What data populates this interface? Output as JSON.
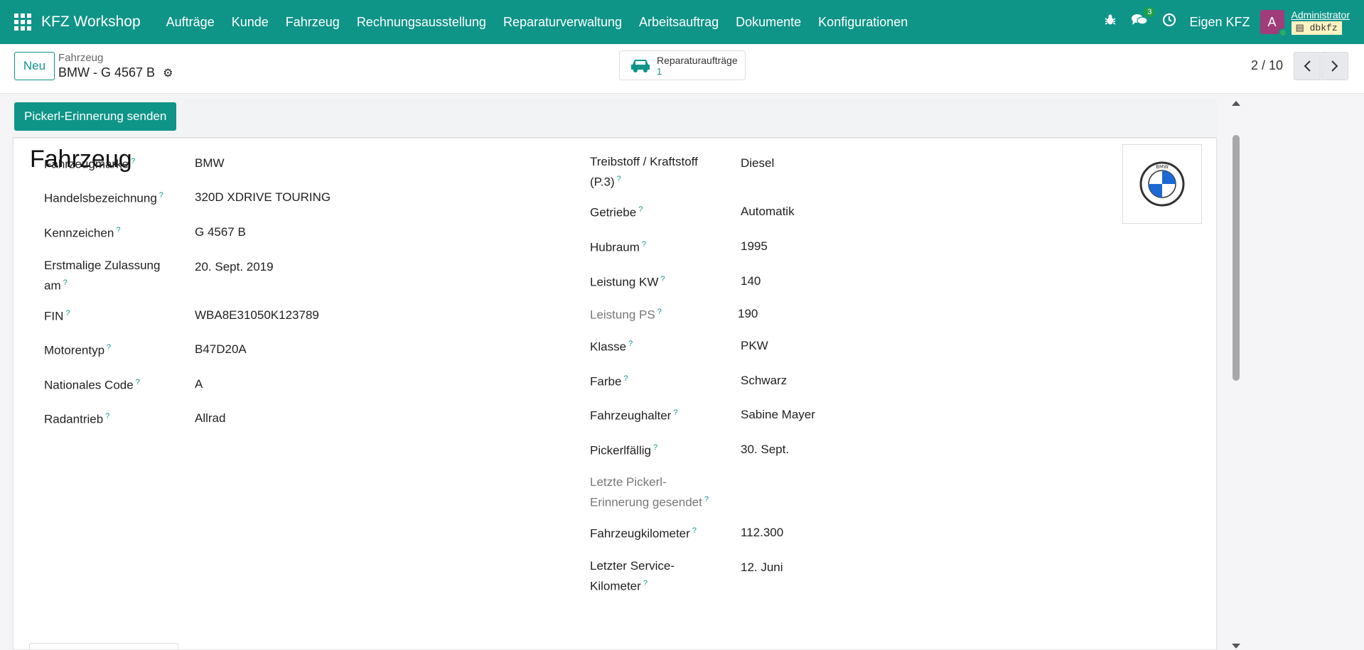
{
  "navbar": {
    "brand": "KFZ Workshop",
    "menu": [
      "Aufträge",
      "Kunde",
      "Fahrzeug",
      "Rechnungsausstellung",
      "Reparaturverwaltung",
      "Arbeitsauftrag",
      "Dokumente",
      "Konfigurationen"
    ],
    "messages_count": "3",
    "company": "Eigen KFZ",
    "avatar_letter": "A",
    "user": "Administrator",
    "db": "dbkfz"
  },
  "control": {
    "new_label": "Neu",
    "breadcrumb_parent": "Fahrzeug",
    "breadcrumb_current": "BMW - G 4567 B",
    "smart_button_label": "Reparaturaufträge",
    "smart_button_count": "1",
    "pager": "2 / 10"
  },
  "statusbar": {
    "action_label": "Pickerl-Erinnerung senden"
  },
  "form": {
    "title": "Fahrzeug",
    "left": [
      {
        "label": "Fahrzeugmarke",
        "value": "BMW"
      },
      {
        "label": "Handelsbezeichnung",
        "value": "320D XDRIVE TOURING"
      },
      {
        "label": "Kennzeichen",
        "value": "G 4567 B"
      },
      {
        "label_line1": "Erstmalige Zulassung",
        "label_line2": "am",
        "value": "20. Sept. 2019"
      },
      {
        "label": "FIN",
        "value": "WBA8E31050K123789"
      },
      {
        "label": "Motorentyp",
        "value": "B47D20A"
      },
      {
        "label": "Nationales Code",
        "value": "A"
      },
      {
        "label": "Radantrieb",
        "value": "Allrad"
      }
    ],
    "right": [
      {
        "label_line1": "Treibstoff / Kraftstoff",
        "label_line2": "(P.3)",
        "value": "Diesel"
      },
      {
        "label": "Getriebe",
        "value": "Automatik"
      },
      {
        "label": "Hubraum",
        "value": "1995"
      },
      {
        "label": "Leistung KW",
        "value": "140"
      },
      {
        "label": "Leistung PS",
        "value": "190"
      },
      {
        "label": "Klasse",
        "value": "PKW"
      },
      {
        "label": "Farbe",
        "value": "Schwarz"
      },
      {
        "label": "Fahrzeughalter",
        "value": "Sabine Mayer"
      },
      {
        "label": "Pickerlfällig",
        "value": "30. Sept."
      },
      {
        "label_line1": "Letzte Pickerl-",
        "label_line2": "Erinnerung gesendet",
        "value": ""
      },
      {
        "label": "Fahrzeugkilometer",
        "value": "112.300"
      },
      {
        "label_line1": "Letzter Service-",
        "label_line2": "Kilometer",
        "value": "12. Juni"
      }
    ],
    "help_marker": "?",
    "logo_text": "BMW"
  }
}
